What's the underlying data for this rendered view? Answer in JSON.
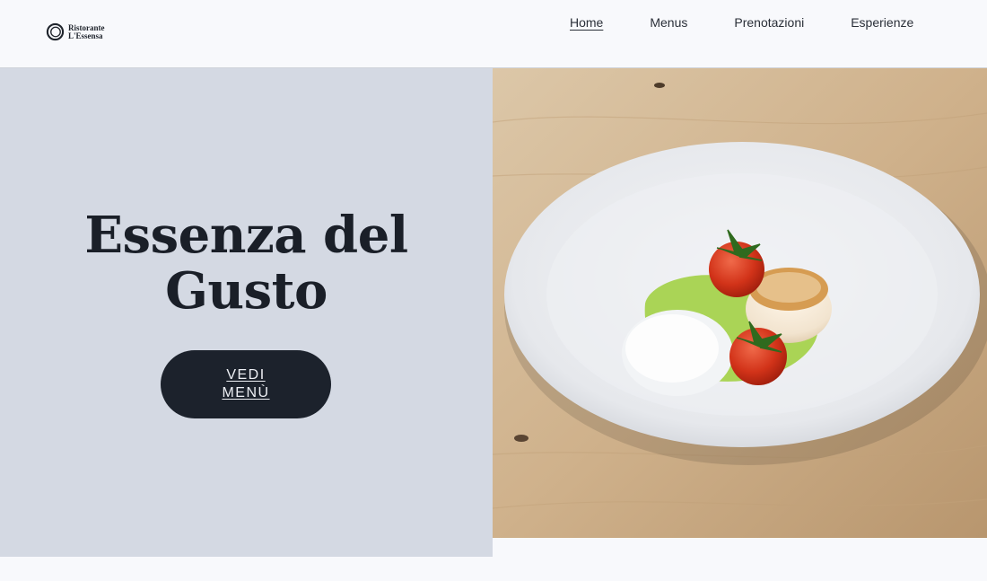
{
  "header": {
    "logo": {
      "line1": "Ristorante",
      "line2": "L'Essensa"
    },
    "nav": [
      {
        "label": "Home",
        "active": true
      },
      {
        "label": "Menus",
        "active": false
      },
      {
        "label": "Prenotazioni",
        "active": false
      },
      {
        "label": "Esperienze",
        "active": false
      }
    ]
  },
  "hero": {
    "title_line1": "Essenza del",
    "title_line2": "Gusto",
    "cta_label": "VEDI MENÙ",
    "image_subject": "scallop with cherry tomatoes on white plate"
  },
  "colors": {
    "background": "#f8f9fc",
    "panel": "#d4d9e3",
    "button": "#1c222c",
    "text": "#1a1f28"
  }
}
